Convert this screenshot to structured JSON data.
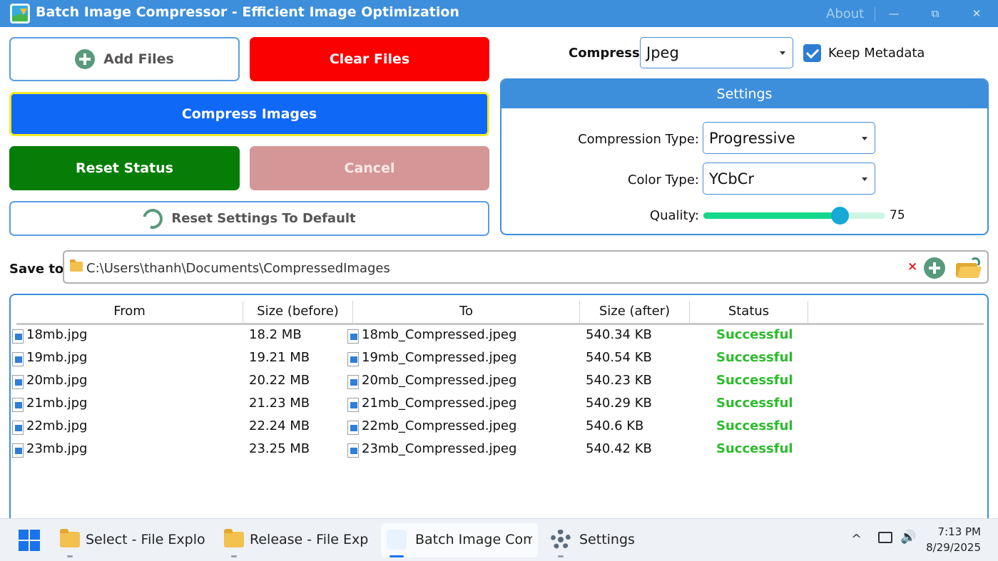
{
  "window": {
    "title": "Batch Image Compressor - Efficient Image Optimization",
    "about": "About",
    "minimize": "—",
    "maximize": "⧉",
    "close": "✕"
  },
  "actions": {
    "add_files": "Add Files",
    "clear_files": "Clear Files",
    "compress": "Compress Images",
    "reset_status": "Reset Status",
    "cancel": "Cancel",
    "reset_settings": "Reset Settings To Default"
  },
  "compress_format": {
    "label": "Compress:",
    "value": "Jpeg"
  },
  "keep_metadata": {
    "label": "Keep Metadata",
    "checked": true
  },
  "settings": {
    "header": "Settings",
    "compression_type_label": "Compression Type:",
    "compression_type_value": "Progressive",
    "color_type_label": "Color Type:",
    "color_type_value": "YCbCr",
    "quality_label": "Quality:",
    "quality_value": "75",
    "quality_fraction": 0.75
  },
  "save_to": {
    "label": "Save to:",
    "path": "C:\\Users\\thanh\\Documents\\CompressedImages",
    "clear_glyph": "×"
  },
  "table": {
    "columns": [
      "From",
      "Size (before)",
      "To",
      "Size (after)",
      "Status"
    ],
    "rows": [
      {
        "from": "18mb.jpg",
        "size_before": "18.2 MB",
        "to": "18mb_Compressed.jpeg",
        "size_after": "540.34 KB",
        "status": "Successful"
      },
      {
        "from": "19mb.jpg",
        "size_before": "19.21 MB",
        "to": "19mb_Compressed.jpeg",
        "size_after": "540.54 KB",
        "status": "Successful"
      },
      {
        "from": "20mb.jpg",
        "size_before": "20.22 MB",
        "to": "20mb_Compressed.jpeg",
        "size_after": "540.23 KB",
        "status": "Successful"
      },
      {
        "from": "21mb.jpg",
        "size_before": "21.23 MB",
        "to": "21mb_Compressed.jpeg",
        "size_after": "540.29 KB",
        "status": "Successful"
      },
      {
        "from": "22mb.jpg",
        "size_before": "22.24 MB",
        "to": "22mb_Compressed.jpeg",
        "size_after": "540.6 KB",
        "status": "Successful"
      },
      {
        "from": "23mb.jpg",
        "size_before": "23.25 MB",
        "to": "23mb_Compressed.jpeg",
        "size_after": "540.42 KB",
        "status": "Successful"
      }
    ]
  },
  "taskbar": {
    "tasks": [
      "Select - File Explor",
      "Release - File Explo",
      "Batch Image Comp",
      "Settings"
    ],
    "tray_chevron": "^",
    "tray_speaker": "🔊",
    "time": "7:13 PM",
    "date": "8/29/2025"
  },
  "colors": {
    "accent": "#3d8fdb",
    "clear": "#fb0000",
    "compress": "#1068f6",
    "reset_status": "#067d06",
    "cancel": "#d49696",
    "success": "#2cbb2c"
  }
}
